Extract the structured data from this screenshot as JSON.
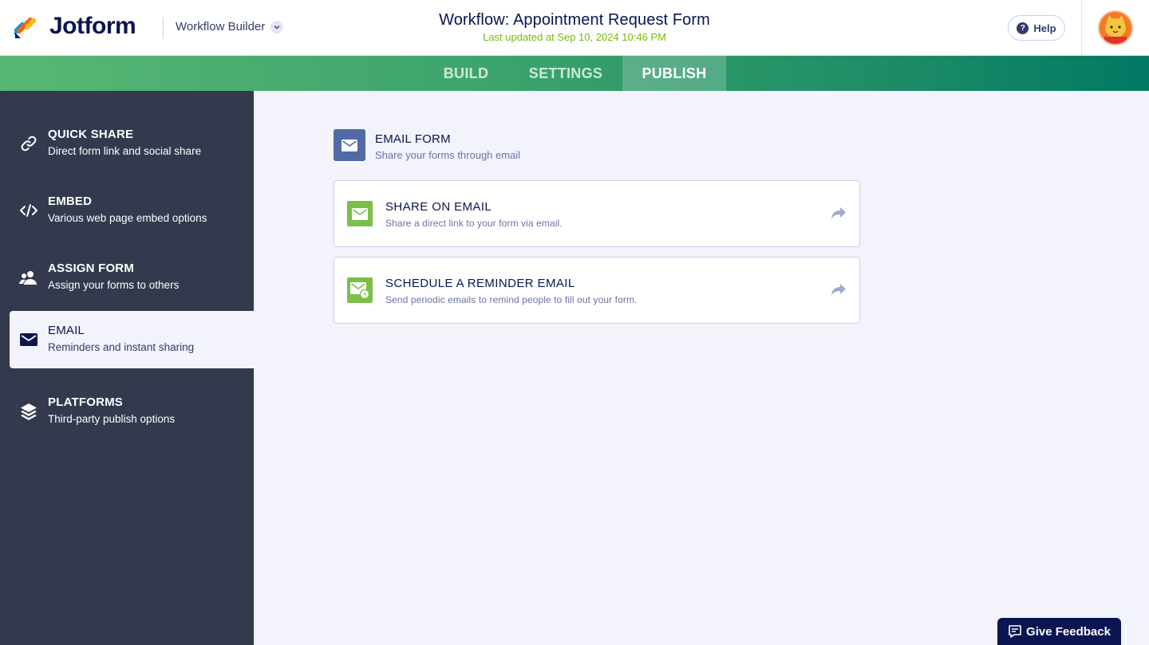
{
  "brand": {
    "name": "Jotform"
  },
  "header": {
    "builder_label": "Workflow Builder",
    "title": "Workflow: Appointment Request Form",
    "subtitle": "Last updated at Sep 10, 2024 10:46 PM",
    "help_label": "Help"
  },
  "tabs": [
    {
      "label": "BUILD",
      "active": false
    },
    {
      "label": "SETTINGS",
      "active": false
    },
    {
      "label": "PUBLISH",
      "active": true
    }
  ],
  "sidebar": {
    "items": [
      {
        "title": "QUICK SHARE",
        "subtitle": "Direct form link and social share",
        "icon": "link-icon",
        "active": false
      },
      {
        "title": "EMBED",
        "subtitle": "Various web page embed options",
        "icon": "code-icon",
        "active": false
      },
      {
        "title": "ASSIGN FORM",
        "subtitle": "Assign your forms to others",
        "icon": "users-icon",
        "active": false
      },
      {
        "title": "EMAIL",
        "subtitle": "Reminders and instant sharing",
        "icon": "envelope-icon",
        "active": true
      },
      {
        "title": "PLATFORMS",
        "subtitle": "Third-party publish options",
        "icon": "layers-icon",
        "active": false
      }
    ]
  },
  "main": {
    "section_title": "EMAIL FORM",
    "section_subtitle": "Share your forms through email",
    "cards": [
      {
        "title": "SHARE ON EMAIL",
        "subtitle": "Share a direct link to your form via email.",
        "icon": "envelope-icon"
      },
      {
        "title": "SCHEDULE A REMINDER EMAIL",
        "subtitle": "Send periodic emails to remind people to fill out your form.",
        "icon": "envelope-clock-icon"
      }
    ]
  },
  "feedback": {
    "label": "Give Feedback"
  },
  "colors": {
    "navy": "#0a1551",
    "sidebar_bg": "#343a4d",
    "content_bg": "#f2f3fb",
    "accent_green": "#7bbf4b",
    "section_icon_bg": "#4f6aa6",
    "subtitle_green": "#78bb07"
  }
}
